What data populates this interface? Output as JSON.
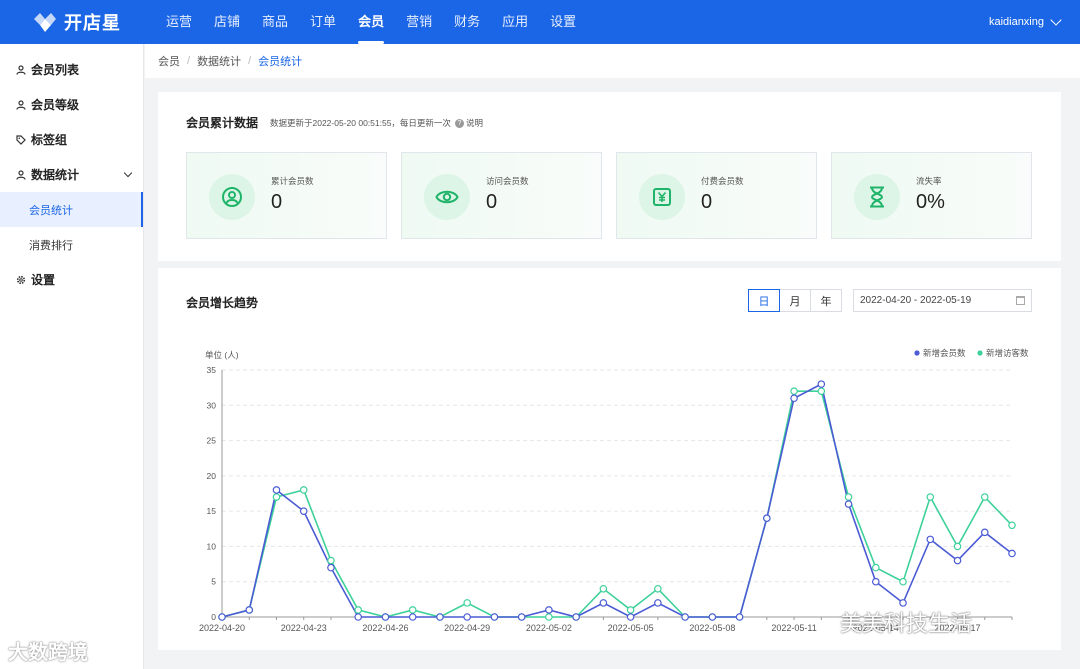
{
  "app": {
    "name": "开店星"
  },
  "nav": {
    "items": [
      {
        "label": "运营"
      },
      {
        "label": "店铺"
      },
      {
        "label": "商品"
      },
      {
        "label": "订单"
      },
      {
        "label": "会员",
        "active": true
      },
      {
        "label": "营销"
      },
      {
        "label": "财务"
      },
      {
        "label": "应用"
      },
      {
        "label": "设置"
      }
    ],
    "user": "kaidianxing"
  },
  "sidebar": {
    "items": [
      {
        "label": "会员列表",
        "icon": "user-icon"
      },
      {
        "label": "会员等级",
        "icon": "user-level-icon"
      },
      {
        "label": "标签组",
        "icon": "tag-icon"
      },
      {
        "label": "数据统计",
        "icon": "user-stat-icon"
      },
      {
        "label": "设置",
        "icon": "gear-icon"
      }
    ],
    "sub": [
      {
        "label": "会员统计",
        "active": true
      },
      {
        "label": "消费排行"
      }
    ]
  },
  "breadcrumb": [
    "会员",
    "数据统计",
    "会员统计"
  ],
  "summary": {
    "title": "会员累计数据",
    "note": "数据更新于2022-05-20 00:51:55，每日更新一次",
    "help": "说明",
    "stats": [
      {
        "label": "累计会员数",
        "value": "0",
        "icon": "user-circle-icon"
      },
      {
        "label": "访问会员数",
        "value": "0",
        "icon": "eye-icon"
      },
      {
        "label": "付费会员数",
        "value": "0",
        "icon": "yen-icon"
      },
      {
        "label": "流失率",
        "value": "0%",
        "icon": "hourglass-icon"
      }
    ]
  },
  "trend": {
    "title": "会员增长趋势",
    "periods": [
      "日",
      "月",
      "年"
    ],
    "selected_period": "日",
    "date_range": "2022-04-20 - 2022-05-19"
  },
  "chart_data": {
    "type": "line",
    "ylabel": "单位 (人)",
    "ylim": [
      0,
      35
    ],
    "yticks": [
      0,
      5,
      10,
      15,
      20,
      25,
      30,
      35
    ],
    "x": [
      "2022-04-20",
      "2022-04-21",
      "2022-04-22",
      "2022-04-23",
      "2022-04-24",
      "2022-04-25",
      "2022-04-26",
      "2022-04-27",
      "2022-04-28",
      "2022-04-29",
      "2022-04-30",
      "2022-05-01",
      "2022-05-02",
      "2022-05-03",
      "2022-05-04",
      "2022-05-05",
      "2022-05-06",
      "2022-05-07",
      "2022-05-08",
      "2022-05-09",
      "2022-05-10",
      "2022-05-11",
      "2022-05-12",
      "2022-05-13",
      "2022-05-14",
      "2022-05-15",
      "2022-05-16",
      "2022-05-17",
      "2022-05-18",
      "2022-05-19"
    ],
    "xtick_labels": [
      "2022-04-20",
      "2022-04-23",
      "2022-04-26",
      "2022-04-29",
      "2022-05-02",
      "2022-05-05",
      "2022-05-08",
      "2022-05-11",
      "2022-05-14",
      "2022-05-17"
    ],
    "grid": true,
    "legend": "top-right",
    "series": [
      {
        "name": "新增会员数",
        "color": "#4a5bd4",
        "values": [
          0,
          1,
          18,
          15,
          7,
          0,
          0,
          0,
          0,
          0,
          0,
          0,
          1,
          0,
          2,
          0,
          2,
          0,
          0,
          0,
          14,
          31,
          33,
          16,
          5,
          2,
          11,
          8,
          12,
          9
        ]
      },
      {
        "name": "新增访客数",
        "color": "#3ed19a",
        "values": [
          0,
          1,
          17,
          18,
          8,
          1,
          0,
          1,
          0,
          2,
          0,
          0,
          0,
          0,
          4,
          1,
          4,
          0,
          0,
          0,
          14,
          32,
          32,
          17,
          7,
          5,
          17,
          10,
          17,
          13
        ]
      }
    ]
  },
  "watermarks": {
    "left": "大数跨境",
    "right": "美美科技生活"
  }
}
